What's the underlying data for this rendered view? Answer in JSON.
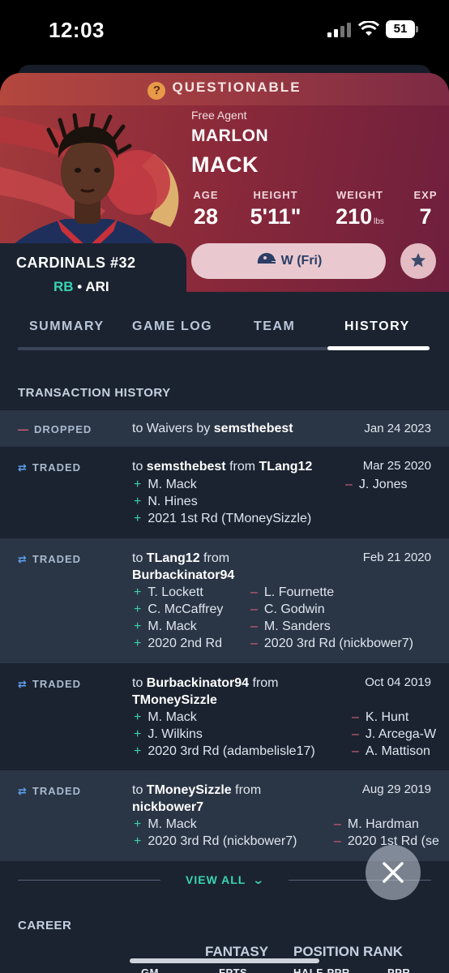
{
  "status_bar": {
    "time": "12:03",
    "battery": "51"
  },
  "badge": {
    "label": "QUESTIONABLE",
    "icon": "question-icon"
  },
  "player": {
    "status": "Free Agent",
    "first_name": "MARLON",
    "last_name": "MACK",
    "team_number": "CARDINALS  #32",
    "position": "RB",
    "team": "• ARI"
  },
  "stats": [
    {
      "label": "AGE",
      "value": "28",
      "unit": ""
    },
    {
      "label": "HEIGHT",
      "value": "5'11\"",
      "unit": ""
    },
    {
      "label": "WEIGHT",
      "value": "210",
      "unit": "lbs"
    },
    {
      "label": "EXP",
      "value": "7",
      "unit": ""
    }
  ],
  "bye_button": {
    "label": "W (Fri)"
  },
  "tabs": [
    "SUMMARY",
    "GAME LOG",
    "TEAM",
    "HISTORY"
  ],
  "active_tab": "HISTORY",
  "section_title": "TRANSACTION HISTORY",
  "transactions": [
    {
      "type": "DROPPED",
      "pre": "to Waivers by ",
      "to": "semsthebest",
      "mid": "",
      "from": "",
      "date": "Jan 24 2023",
      "gained": [],
      "lost": []
    },
    {
      "type": "TRADED",
      "pre": "to ",
      "to": "semsthebest",
      "mid": " from ",
      "from": "TLang12",
      "date": "Mar 25 2020",
      "gained": [
        "M. Mack",
        "N. Hines",
        "2021 1st Rd (TMoneySizzle)"
      ],
      "lost": [
        "J. Jones"
      ]
    },
    {
      "type": "TRADED",
      "pre": "to ",
      "to": "TLang12",
      "mid": " from",
      "from": "Burbackinator94",
      "date": "Feb 21 2020",
      "gained": [
        "T. Lockett",
        "C. McCaffrey",
        "M. Mack",
        "2020 2nd Rd"
      ],
      "lost": [
        "L. Fournette",
        "C. Godwin",
        "M. Sanders",
        "2020 3rd Rd (nickbower7)"
      ]
    },
    {
      "type": "TRADED",
      "pre": "to ",
      "to": "Burbackinator94",
      "mid": " from",
      "from": "TMoneySizzle",
      "date": "Oct 04 2019",
      "gained": [
        "M. Mack",
        "J. Wilkins",
        "2020 3rd Rd (adambelisle17)"
      ],
      "lost": [
        "K. Hunt",
        "J. Arcega-W",
        "A. Mattison"
      ]
    },
    {
      "type": "TRADED",
      "pre": "to ",
      "to": "TMoneySizzle",
      "mid": " from",
      "from": "nickbower7",
      "date": "Aug 29 2019",
      "gained": [
        "M. Mack",
        "2020 3rd Rd (nickbower7)"
      ],
      "lost": [
        "M. Hardman",
        "2020 1st Rd (se"
      ]
    }
  ],
  "view_all": "VIEW ALL",
  "career": {
    "title": "CAREER",
    "group_headers": [
      "FANTASY",
      "POSITION RANK"
    ],
    "columns": [
      "GM",
      "FPTS",
      "HALF-PPR",
      "PPR"
    ]
  },
  "colors": {
    "accent_teal": "#39d4b4",
    "gain": "#3fcfa8",
    "loss": "#e0607a",
    "hero": "#8c2a3a"
  }
}
